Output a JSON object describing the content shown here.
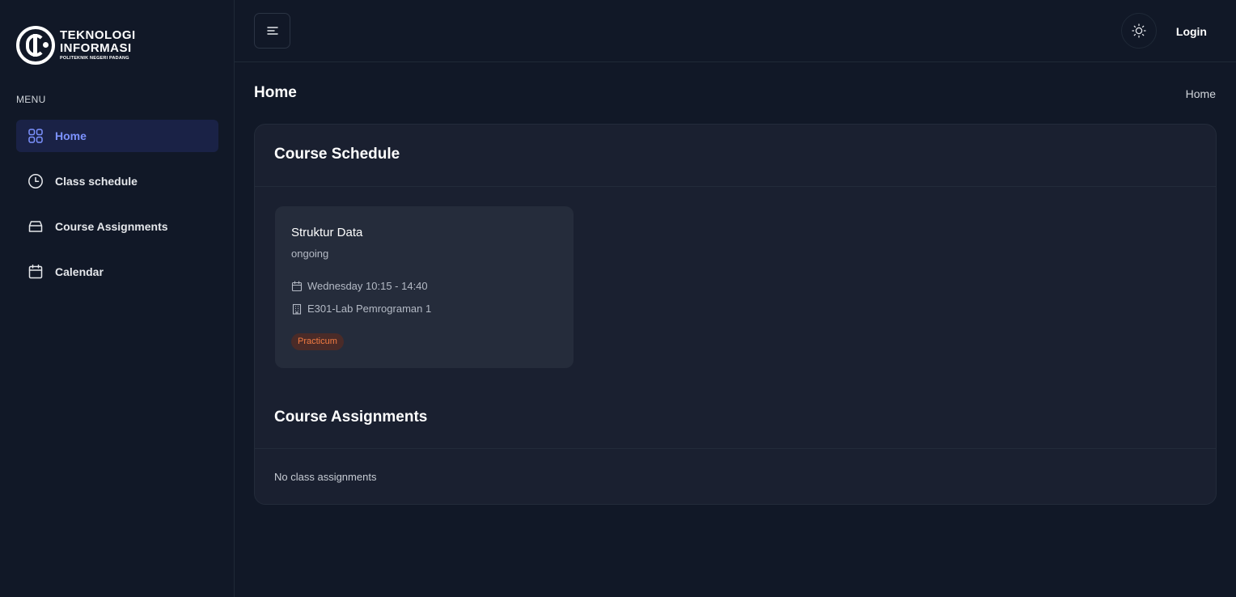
{
  "logo": {
    "line1": "TEKNOLOGI",
    "line2": "INFORMASI",
    "line3": "POLITEKNIK NEGERI PADANG"
  },
  "sidebar": {
    "menu_heading": "MENU",
    "items": [
      {
        "label": "Home",
        "icon": "grid-icon",
        "active": true
      },
      {
        "label": "Class schedule",
        "icon": "clock-icon",
        "active": false
      },
      {
        "label": "Course Assignments",
        "icon": "archive-icon",
        "active": false
      },
      {
        "label": "Calendar",
        "icon": "calendar-icon",
        "active": false
      }
    ]
  },
  "header": {
    "menu_toggle_icon": "hamburger-icon",
    "theme_icon": "sun-icon",
    "login_label": "Login"
  },
  "page": {
    "title": "Home",
    "breadcrumb": "Home"
  },
  "schedule": {
    "title": "Course Schedule",
    "courses": [
      {
        "name": "Struktur Data",
        "status": "ongoing",
        "time": "Wednesday 10:15 - 14:40",
        "room": "E301-Lab Pemrograman 1",
        "badge": "Practicum"
      }
    ]
  },
  "assignments": {
    "title": "Course Assignments",
    "empty_text": "No class assignments"
  },
  "colors": {
    "background": "#111827",
    "panel": "#1a2030",
    "card": "#252c3b",
    "accent": "#7c92ff",
    "active_bg": "#1a2246",
    "badge_text": "#f47c42",
    "badge_bg": "#4a2b28"
  }
}
